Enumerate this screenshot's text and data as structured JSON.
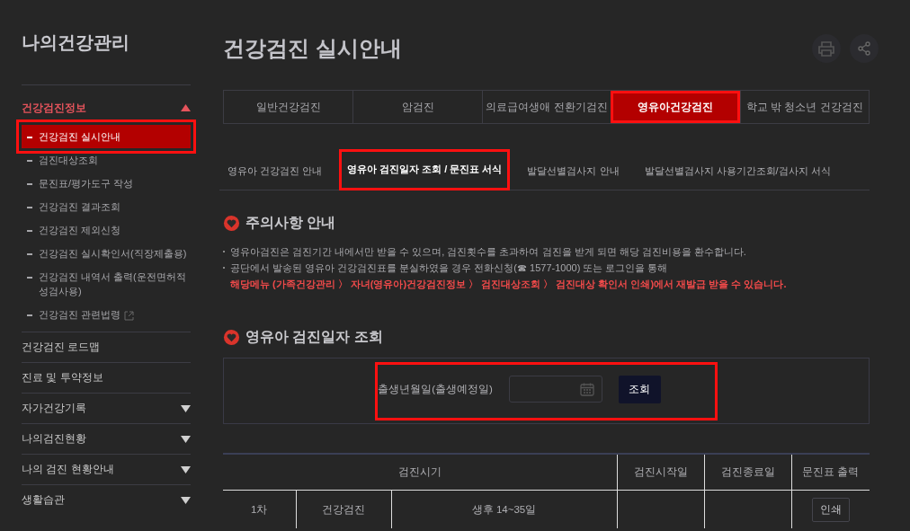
{
  "sidebar": {
    "title": "나의건강관리",
    "sections": [
      {
        "label": "건강검진정보",
        "kind": "group",
        "expanded": true,
        "children": [
          {
            "label": "건강검진 실시안내",
            "selected": true,
            "highlighted": true,
            "external": false
          },
          {
            "label": "검진대상조회",
            "selected": false,
            "highlighted": false,
            "external": false
          },
          {
            "label": "문진표/평가도구 작성",
            "selected": false,
            "highlighted": false,
            "external": false
          },
          {
            "label": "건강검진 결과조회",
            "selected": false,
            "highlighted": false,
            "external": false
          },
          {
            "label": "건강검진 제외신청",
            "selected": false,
            "highlighted": false,
            "external": false
          },
          {
            "label": "건강검진 실시확인서(직장제출용)",
            "selected": false,
            "highlighted": false,
            "external": false
          },
          {
            "label": "건강검진 내역서 출력(운전면허적성검사용)",
            "selected": false,
            "highlighted": false,
            "external": false
          },
          {
            "label": "건강검진 관련법령",
            "selected": false,
            "highlighted": false,
            "external": true
          }
        ]
      },
      {
        "label": "건강검진 로드맵",
        "kind": "link"
      },
      {
        "label": "진료 및 투약정보",
        "kind": "link"
      },
      {
        "label": "자가건강기록",
        "kind": "group",
        "expanded": false
      },
      {
        "label": "나의검진현황",
        "kind": "group",
        "expanded": false
      },
      {
        "label": "나의 검진 현황안내",
        "kind": "group",
        "expanded": false
      },
      {
        "label": "생활습관",
        "kind": "group",
        "expanded": false
      }
    ]
  },
  "page": {
    "title": "건강검진 실시안내",
    "tabs": [
      {
        "label": "일반건강검진",
        "selected": false,
        "highlighted": false
      },
      {
        "label": "암검진",
        "selected": false,
        "highlighted": false
      },
      {
        "label": "의료급여생애 전환기검진",
        "selected": false,
        "highlighted": false
      },
      {
        "label": "영유아건강검진",
        "selected": true,
        "highlighted": true
      },
      {
        "label": "학교 밖 청소년 건강검진",
        "selected": false,
        "highlighted": false
      }
    ],
    "subtabs": [
      {
        "label": "영유아 건강검진 안내",
        "selected": false,
        "highlighted": false
      },
      {
        "label": "영유아 검진일자 조회 / 문진표 서식",
        "selected": true,
        "highlighted": true
      },
      {
        "label": "발달선별검사지 안내",
        "selected": false,
        "highlighted": false
      },
      {
        "label": "발달선별검사지 사용기간조회/검사지 서식",
        "selected": false,
        "highlighted": false
      }
    ],
    "notice": {
      "heading": "주의사항 안내",
      "items": [
        {
          "text": "영유아검진은 검진기간 내에서만 받을 수 있으며, 검진횟수를 초과하여 검진을 받게 되면 해당 검진비용을 환수합니다."
        },
        {
          "text": "공단에서 발송된 영유아 건강검진표를 분실하였을 경우 전화신청(☎ 1577-1000) 또는 로그인을 통해",
          "note": "해당메뉴 (가족건강관리 〉 자녀(영유아)건강검진정보 〉 검진대상조회 〉 검진대상 확인서 인쇄)에서 재발급 받을 수 있습니다."
        }
      ]
    },
    "search": {
      "heading": "영유아 검진일자 조회",
      "label": "출생년월일(출생예정일)",
      "button": "조회",
      "highlighted": true
    },
    "table": {
      "columns": [
        "검진시기",
        "검진시작일",
        "검진종료일",
        "문진표 출력"
      ],
      "rows": [
        {
          "round": "1차",
          "type": "건강검진",
          "period": "생후 14~35일",
          "action": "인쇄"
        }
      ]
    }
  }
}
